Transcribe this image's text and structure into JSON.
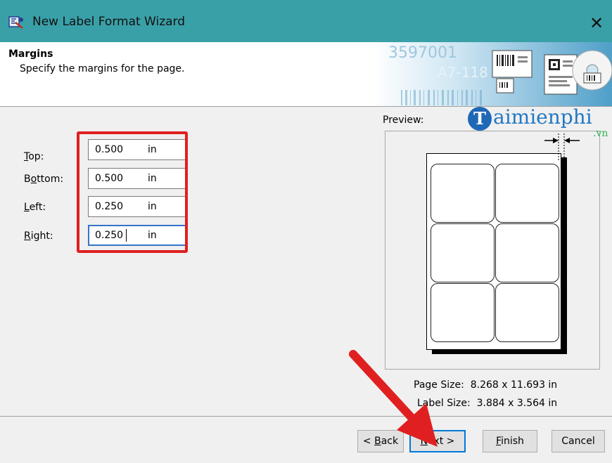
{
  "window": {
    "title": "New Label Format Wizard",
    "close_glyph": "✕"
  },
  "header": {
    "title": "Margins",
    "subtitle": "Specify the margins for the page.",
    "banner_text_1": "3597001",
    "banner_text_2": "A7-118"
  },
  "fields": [
    {
      "label_first": "T",
      "label_rest": "op:",
      "value": "0.500",
      "unit": "in"
    },
    {
      "label_first": "B",
      "label_first_plain": "",
      "label_rest": "ottom:",
      "value": "0.500",
      "unit": "in"
    },
    {
      "label_first": "L",
      "label_rest": "eft:",
      "value": "0.250",
      "unit": "in"
    },
    {
      "label_first": "R",
      "label_rest": "ight:",
      "value": "0.250",
      "unit": "in"
    }
  ],
  "bottom_label": {
    "pre": "B",
    "mnemonic": "o",
    "post": "ttom:"
  },
  "preview": {
    "label": "Preview:",
    "page_size_label": "Page Size:",
    "page_size_value": "8.268 x 11.693 in",
    "label_size_label": "Label Size:",
    "label_size_value": "3.884 x 3.564 in"
  },
  "watermark": {
    "logo_letter": "T",
    "text": "aimienphi",
    "suffix": ".vn"
  },
  "buttons": {
    "back_pre": "< ",
    "back_mnemonic": "B",
    "back_post": "ack",
    "next_mnemonic": "N",
    "next_post": "ext >",
    "finish_mnemonic": "F",
    "finish_post": "inish",
    "cancel": "Cancel"
  },
  "colors": {
    "titlebar": "#3aa0a8",
    "highlight": "#e02020",
    "focus": "#0078d7"
  }
}
